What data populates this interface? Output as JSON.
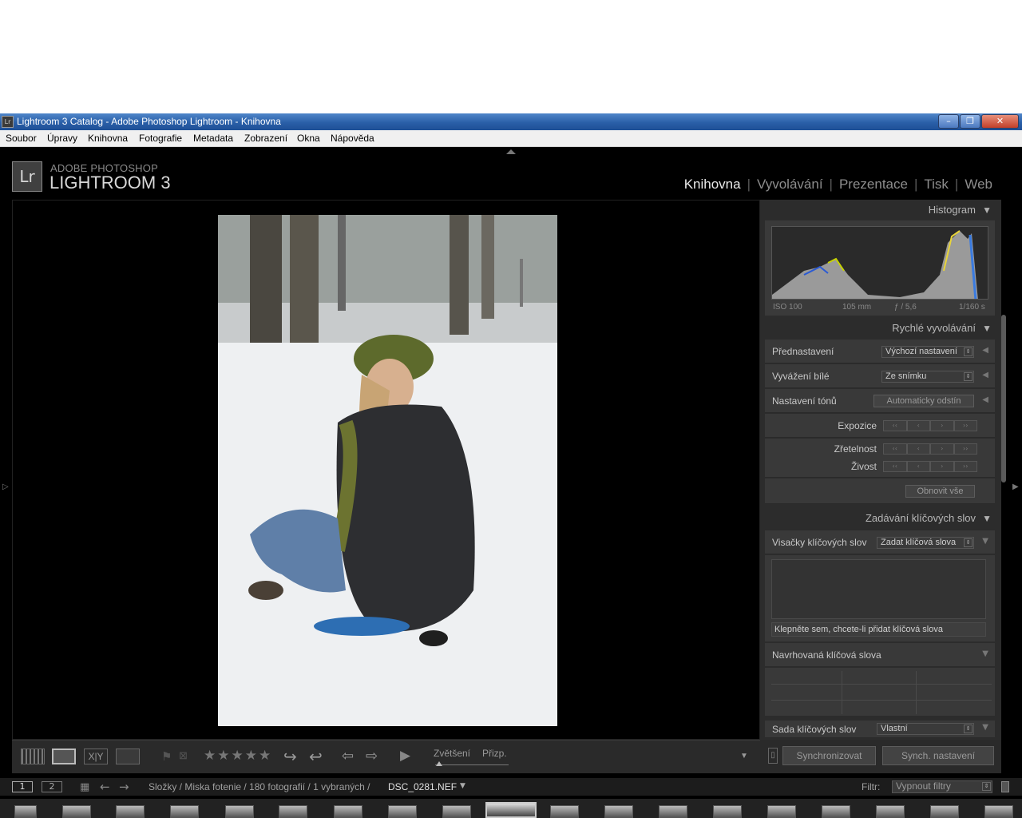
{
  "window": {
    "title": "Lightroom 3 Catalog - Adobe Photoshop Lightroom - Knihovna",
    "app_badge": "Lr",
    "minimize": "–",
    "maximize": "❐",
    "close": "✕"
  },
  "menu": [
    "Soubor",
    "Úpravy",
    "Knihovna",
    "Fotografie",
    "Metadata",
    "Zobrazení",
    "Okna",
    "Nápověda"
  ],
  "header": {
    "logo": "Lr",
    "brand_top": "ADOBE PHOTOSHOP",
    "brand_main": "LIGHTROOM 3",
    "modules": [
      "Knihovna",
      "Vyvolávání",
      "Prezentace",
      "Tisk",
      "Web"
    ],
    "separator": "|"
  },
  "histogram": {
    "title": "Histogram",
    "iso": "ISO 100",
    "focal": "105 mm",
    "aperture": "ƒ / 5,6",
    "shutter": "1/160 s"
  },
  "quick_develop": {
    "title": "Rychlé vyvolávání",
    "preset_label": "Přednastavení",
    "preset_value": "Výchozí nastavení",
    "wb_label": "Vyvážení bílé",
    "wb_value": "Ze snímku",
    "tone_label": "Nastavení tónů",
    "auto_tone": "Automaticky odstín",
    "exposure": "Expozice",
    "clarity": "Zřetelnost",
    "vibrance": "Živost",
    "reset_all": "Obnovit vše",
    "step_buttons": [
      "‹‹",
      "‹",
      "›",
      "››"
    ]
  },
  "keywording": {
    "title": "Zadávání klíčových slov",
    "tags_label": "Visačky klíčových slov",
    "tags_value": "Zadat klíčová slova",
    "add_placeholder": "Klepněte sem, chcete-li přidat klíčová slova",
    "suggested": "Navrhovaná klíčová slova",
    "set_label": "Sada klíčových slov",
    "set_value": "Vlastní"
  },
  "toolbar": {
    "zoom_label": "Zvětšení",
    "fit_label": "Přizp.",
    "stars": "★★★★★"
  },
  "sync": {
    "sync_label": "Synchronizovat",
    "sync_settings_label": "Synch. nastavení"
  },
  "filmbar": {
    "screen1": "1",
    "screen2": "2",
    "path": "Složky / Miska fotenie / 180 fotografií / 1 vybraných /",
    "filename": "DSC_0281.NEF",
    "filter_label": "Filtr:",
    "filter_value": "Vypnout filtry"
  }
}
